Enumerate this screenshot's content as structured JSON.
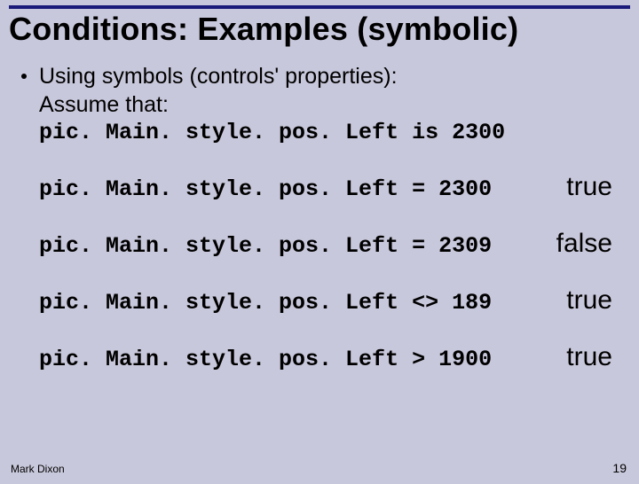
{
  "title": "Conditions: Examples (symbolic)",
  "intro": {
    "line1": "Using symbols (controls' properties):",
    "line2": "Assume that:",
    "line3": "pic. Main. style. pos. Left is 2300"
  },
  "examples": [
    {
      "code": "pic. Main. style. pos. Left = 2300",
      "result": "true"
    },
    {
      "code": "pic. Main. style. pos. Left = 2309",
      "result": "false"
    },
    {
      "code": "pic. Main. style. pos. Left <> 189",
      "result": "true"
    },
    {
      "code": "pic. Main. style. pos. Left > 1900",
      "result": "true"
    }
  ],
  "footer": {
    "author": "Mark Dixon",
    "page": "19"
  }
}
